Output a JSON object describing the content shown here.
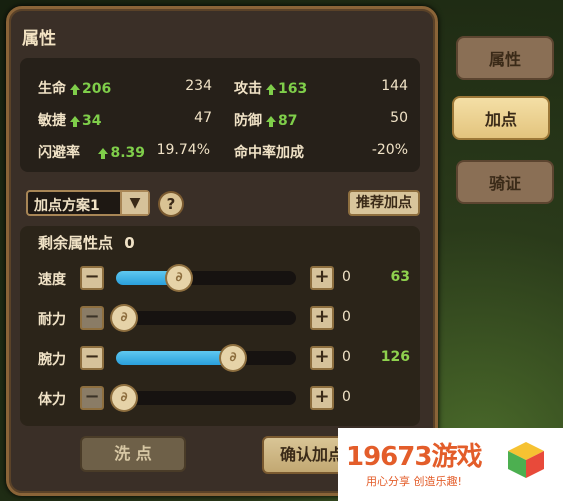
{
  "panel": {
    "title": "属性"
  },
  "stats": {
    "hp": {
      "name": "生命",
      "up": "206",
      "value": "234"
    },
    "atk": {
      "name": "攻击",
      "up": "163",
      "value": "144"
    },
    "agi": {
      "name": "敏捷",
      "up": "34",
      "value": "47"
    },
    "def": {
      "name": "防御",
      "up": "87",
      "value": "50"
    },
    "dodge": {
      "name": "闪避率",
      "up": "8.39",
      "value": "19.74%"
    },
    "hit": {
      "name": "命中率加成",
      "value": "-20%"
    }
  },
  "scheme": {
    "selected": "加点方案1",
    "arrow": "▼"
  },
  "help": "?",
  "recommend_label": "推荐加点",
  "remaining": {
    "label": "剩余属性点",
    "value": "0"
  },
  "rows": [
    {
      "label": "速度",
      "add": "0",
      "total": "63",
      "fill_percent": 35
    },
    {
      "label": "耐力",
      "add": "0",
      "total": "",
      "fill_percent": 0
    },
    {
      "label": "腕力",
      "add": "0",
      "total": "126",
      "fill_percent": 65
    },
    {
      "label": "体力",
      "add": "0",
      "total": "",
      "fill_percent": 0
    }
  ],
  "minus": "−",
  "plus": "+",
  "knob_glyph": "∂",
  "buttons": {
    "wash": "洗 点",
    "confirm": "确认加点"
  },
  "side_tabs": [
    {
      "label": "属性",
      "active": false
    },
    {
      "label": "加点",
      "active": true
    },
    {
      "label": "骑证",
      "active": false
    }
  ],
  "watermark": {
    "title": "19673游戏",
    "subtitle": "用心分享  创造乐趣!"
  },
  "colors": {
    "accent_green": "#7fce4a",
    "bar_blue": "#2aa0dc",
    "gold": "#e3c47e"
  }
}
